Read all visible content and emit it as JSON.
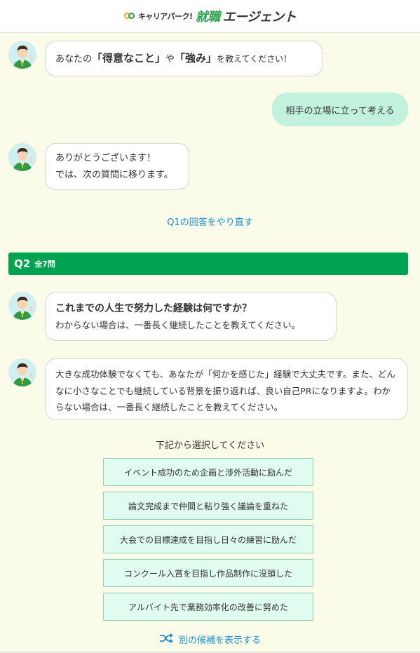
{
  "header": {
    "logo_small": "キャリアパーク!",
    "logo_green": "就職",
    "logo_dark": "エージェント"
  },
  "messages": {
    "q1_prompt_pre": "あなたの",
    "q1_prompt_b1": "「得意なこと」",
    "q1_prompt_mid": "や",
    "q1_prompt_b2": "「強み」",
    "q1_prompt_post": "を教えてください！",
    "user_answer": "相手の立場に立って考える",
    "thanks_line1": "ありがとうございます！",
    "thanks_line2": "では、次の質問に移ります。",
    "redo_link": "Q1の回答をやり直す",
    "q2_title": "これまでの人生で努力した経験は何ですか？",
    "q2_sub": "わからない場合は、一番長く継続したことを教えてください。",
    "q2_hint": "大きな成功体験でなくても、あなたが「何かを感じた」経験で大丈夫です。また、どんなに小さなことでも継続している背景を振り返れば、良い自己PRになりますよ。わからない場合は、一番長く継続したことを教えてください。"
  },
  "question": {
    "number": "Q2",
    "total": "全7問"
  },
  "choices": {
    "label": "下記から選択してください",
    "items": [
      "イベント成功のため企画と渉外活動に励んだ",
      "論文完成まで仲間と粘り強く議論を重ねた",
      "大会での目標達成を目指し日々の練習に励んだ",
      "コンクール入賞を目指し作品制作に没頭した",
      "アルバイト先で業務効率化の改善に努めた"
    ],
    "shuffle_label": "別の候補を表示する"
  },
  "colors": {
    "accent_green": "#00a350",
    "user_bubble": "#c2f2de",
    "link_blue": "#1a8fcf",
    "background": "#fbfbe9"
  },
  "icons": [
    "advisor-avatar-icon",
    "shuffle-icon"
  ]
}
